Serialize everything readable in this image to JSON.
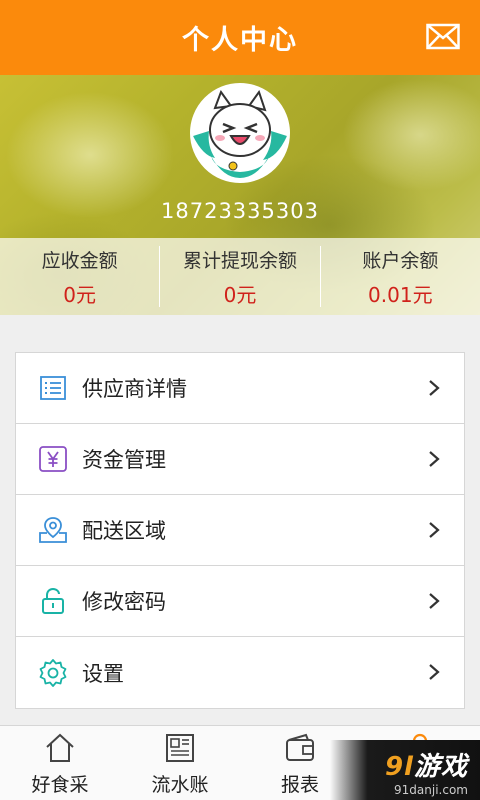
{
  "header": {
    "title": "个人中心",
    "mail_icon": "mail-icon"
  },
  "profile": {
    "phone": "18723335303",
    "avatar_icon": "cat-avatar"
  },
  "stats": [
    {
      "label": "应收金额",
      "value": "0元"
    },
    {
      "label": "累计提现余额",
      "value": "0元"
    },
    {
      "label": "账户余额",
      "value": "0.01元"
    }
  ],
  "menu": [
    {
      "label": "供应商详情",
      "icon": "list-icon"
    },
    {
      "label": "资金管理",
      "icon": "yen-icon"
    },
    {
      "label": "配送区域",
      "icon": "location-icon"
    },
    {
      "label": "修改密码",
      "icon": "lock-icon"
    },
    {
      "label": "设置",
      "icon": "gear-icon"
    }
  ],
  "tabs": [
    {
      "label": "好食采",
      "icon": "home-icon"
    },
    {
      "label": "流水账",
      "icon": "newspaper-icon"
    },
    {
      "label": "报表",
      "icon": "wallet-icon"
    },
    {
      "label": "",
      "icon": "user-icon"
    }
  ],
  "watermark": {
    "title_num": "9l",
    "title_text": "游戏",
    "url": "91danji.com"
  },
  "colors": {
    "accent": "#fb8a0c",
    "value_red": "#d0221b",
    "icon_blue": "#3a8fd8",
    "icon_purple": "#8a4fc4",
    "icon_teal": "#19b3a6"
  }
}
